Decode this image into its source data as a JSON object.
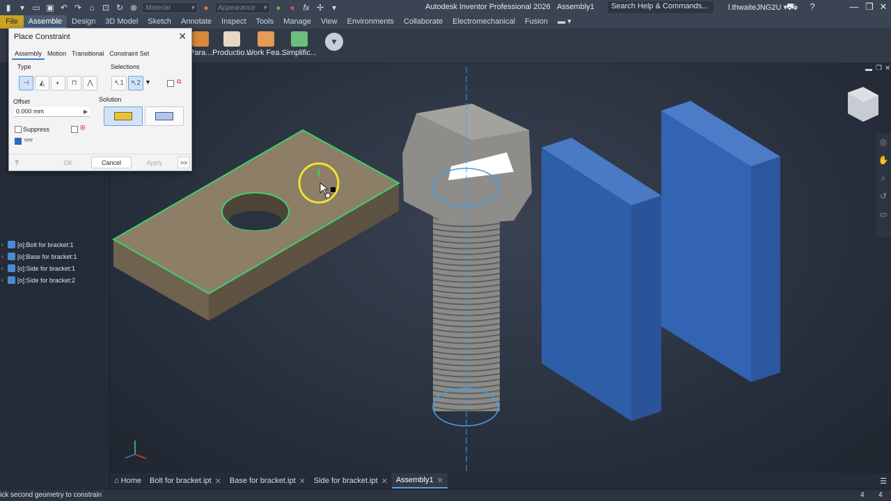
{
  "titlebar": {
    "app_title": "Autodesk Inventor Professional 2026",
    "document": "Assembly1",
    "material_placeholder": "Material",
    "appearance_placeholder": "Appearance",
    "search_placeholder": "Search Help & Commands...",
    "user": "l.thwaiteJNG2U",
    "fx": "fx"
  },
  "menu": [
    "File",
    "Assemble",
    "Design",
    "3D Model",
    "Sketch",
    "Annotate",
    "Inspect",
    "Tools",
    "Manage",
    "View",
    "Environments",
    "Collaborate",
    "Electromechanical",
    "Fusion"
  ],
  "ribbon": {
    "buttons": [
      "Para...",
      "Productio...",
      "Work Fea...",
      "Simplific..."
    ]
  },
  "dialog": {
    "title": "Place Constraint",
    "tabs": [
      "Assembly",
      "Motion",
      "Transitional",
      "Constraint Set"
    ],
    "type_label": "Type",
    "selections_label": "Selections",
    "sel1": "1",
    "sel2": "2",
    "offset_label": "Offset",
    "offset_value": "0.000 mm",
    "solution_label": "Solution",
    "suppress_label": "Suppress",
    "ok": "OK",
    "cancel": "Cancel",
    "apply": "Apply",
    "more": ">>"
  },
  "browser": {
    "items": [
      "[o]:Bolt for bracket:1",
      "[o]:Base for bracket:1",
      "[o]:Side for bracket:1",
      "[o]:Side for bracket:2"
    ]
  },
  "tabs": [
    {
      "label": "Home"
    },
    {
      "label": "Bolt for bracket.ipt"
    },
    {
      "label": "Base for bracket.ipt"
    },
    {
      "label": "Side for bracket.ipt"
    },
    {
      "label": "Assembly1"
    }
  ],
  "status": {
    "text": "ick second geometry to constrain",
    "count1": "4",
    "count2": "4"
  },
  "colors": {
    "accent": "#5aa0e6",
    "file_tab": "#c9a323",
    "base_part": "#8a7b66",
    "side_parts": "#3b6fc2",
    "selection_green": "#3cd26a",
    "axis_blue": "#3aa0f0"
  }
}
